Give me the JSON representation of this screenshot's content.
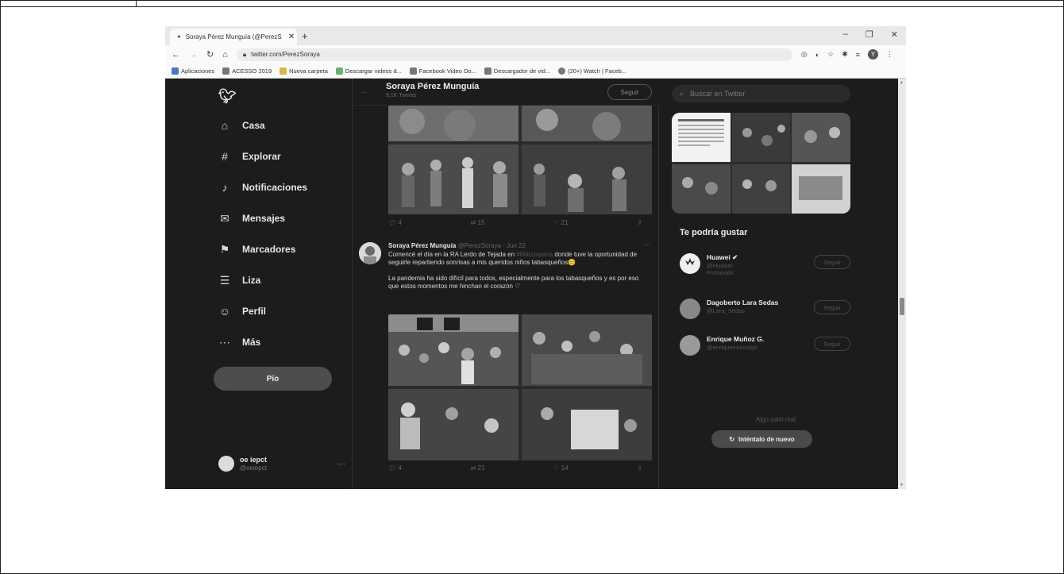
{
  "browser": {
    "tab_title": "Soraya Pérez Munguía (@PerezS",
    "tab_close": "✕",
    "new_tab": "+",
    "url": "twitter.com/PerezSoraya",
    "window_controls": [
      "–",
      "❐",
      "✕"
    ],
    "bookmarks": [
      "Aplicaciones",
      "ACESSO 2019",
      "Nueva carpeta",
      "Descargar videos d...",
      "Facebook Video Do...",
      "Descargador de vid...",
      "(20+) Watch | Faceb..."
    ],
    "profile_initial": "Y"
  },
  "nav": {
    "items": [
      {
        "icon": "⌂",
        "label": "Casa"
      },
      {
        "icon": "#",
        "label": "Explorar"
      },
      {
        "icon": "♪",
        "label": "Notificaciones"
      },
      {
        "icon": "✉",
        "label": "Mensajes"
      },
      {
        "icon": "⚑",
        "label": "Marcadores"
      },
      {
        "icon": "☰",
        "label": "Liza"
      },
      {
        "icon": "☺",
        "label": "Perfil"
      },
      {
        "icon": "⋯",
        "label": "Más"
      }
    ],
    "tweet_button": "Pío",
    "account_name": "oe iepct",
    "account_handle": "@oeiepct",
    "account_more": "···"
  },
  "feed": {
    "header_name": "Soraya Pérez Munguía",
    "header_count": "9,1K Tweets",
    "follow": "Seguir",
    "prev_actions": [
      "4",
      "15",
      "21",
      ""
    ],
    "tweet": {
      "author": "Soraya Pérez Munguía",
      "handle": "@PerezSoraya · Jun 22",
      "line1": "Comencé el día en la RA Lerdo de Tejada en",
      "mention": "#Macuspana",
      "line1b": "donde tuve la",
      "line2": "oportunidad de seguirle repartiendo sonrisas a mis queridos niños tabasqueños😊",
      "paragraph2": "La pandemia ha sido difícil para todos, especialmente para los tabasqueños y es por eso que estos momentos me hinchan el corazón ♡",
      "actions": [
        "4",
        "21",
        "14",
        ""
      ]
    }
  },
  "sidebar": {
    "search_placeholder": "Buscar en Twitter",
    "suggestions_title": "Te podría gustar",
    "users": [
      {
        "name": "Huawei ✔",
        "handle": "@Huawei",
        "extra": "Promovido",
        "follow": "Seguir"
      },
      {
        "name": "Dagoberto Lara Sedas",
        "handle": "@Lara_Sedas",
        "extra": "",
        "follow": "Seguir"
      },
      {
        "name": "Enrique Muñoz G.",
        "handle": "@enriquemunozgo",
        "extra": "",
        "follow": "Seguir"
      }
    ],
    "error_text": "Algo salió mal.",
    "retry": "Inténtalo de nuevo"
  },
  "colors": {
    "background": "#1c1c1d",
    "text": "#e6e6e6",
    "muted": "#666666",
    "button": "#4d4d4f"
  }
}
